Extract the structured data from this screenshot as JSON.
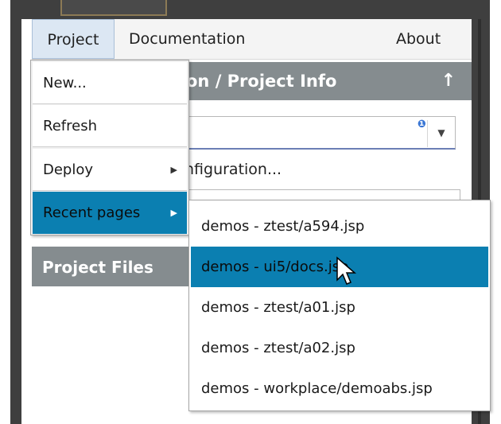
{
  "menubar": {
    "items": [
      {
        "label": "Project"
      },
      {
        "label": "Documentation"
      },
      {
        "label": "About"
      }
    ]
  },
  "background": {
    "section_title": "Configuration / Project Info",
    "section_title_visible": "on / Project Info",
    "section_arrow": "↑",
    "combo_info": "❶",
    "config_text": "nfiguration...",
    "files_header": "Project Files"
  },
  "dropdown": {
    "items": [
      {
        "label": "New..."
      },
      {
        "label": "Refresh"
      },
      {
        "label": "Deploy",
        "submenu": true
      },
      {
        "label": "Recent pages",
        "submenu": true,
        "active": true
      }
    ]
  },
  "recent_pages": {
    "items": [
      {
        "label": "demos - ztest/a594.jsp"
      },
      {
        "label": "demos - ui5/docs.jsp",
        "selected": true
      },
      {
        "label": "demos - ztest/a01.jsp"
      },
      {
        "label": "demos - ztest/a02.jsp"
      },
      {
        "label": "demos - workplace/demoabs.jsp"
      }
    ]
  },
  "colors": {
    "frame": "#3f3f3f",
    "header_gray": "#858c8f",
    "highlight_blue": "#0b7fb1"
  }
}
